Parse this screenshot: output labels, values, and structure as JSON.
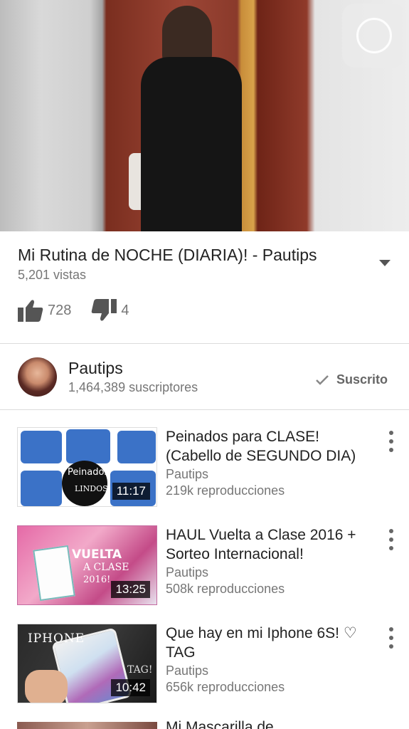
{
  "player": {
    "fullscreen_icon": "fullscreen-circle-icon"
  },
  "video": {
    "title": "Mi Rutina de NOCHE (DIARIA)! - Pautips",
    "views": "5,201 vistas",
    "likes": "728",
    "dislikes": "4",
    "expand_icon": "chevron-down-icon"
  },
  "channel": {
    "name": "Pautips",
    "subscribers": "1,464,389 suscriptores",
    "subscribe_label": "Suscrito",
    "subscribe_icon": "checkmark-icon"
  },
  "related": [
    {
      "title": "Peinados para CLASE! (Cabello de SEGUNDO DIA)",
      "channel": "Pautips",
      "views": "219k reproducciones",
      "duration": "11:17",
      "thumb_text": [
        "Peinados",
        "LINDOS"
      ]
    },
    {
      "title": "HAUL Vuelta a Clase 2016 + Sorteo Internacional!",
      "channel": "Pautips",
      "views": "508k reproducciones",
      "duration": "13:25",
      "thumb_text": [
        "VUELTA",
        "A CLASE",
        "2016!"
      ]
    },
    {
      "title": "Que hay en mi Iphone 6S! ♡ TAG",
      "channel": "Pautips",
      "views": "656k reproducciones",
      "duration": "10:42",
      "thumb_text": [
        "IPHONE",
        "TAG!"
      ]
    },
    {
      "title": "Mi Mascarilla de ..."
    }
  ],
  "colors": {
    "text_primary": "#222222",
    "text_secondary": "#767676",
    "divider": "#dcdcdc"
  }
}
